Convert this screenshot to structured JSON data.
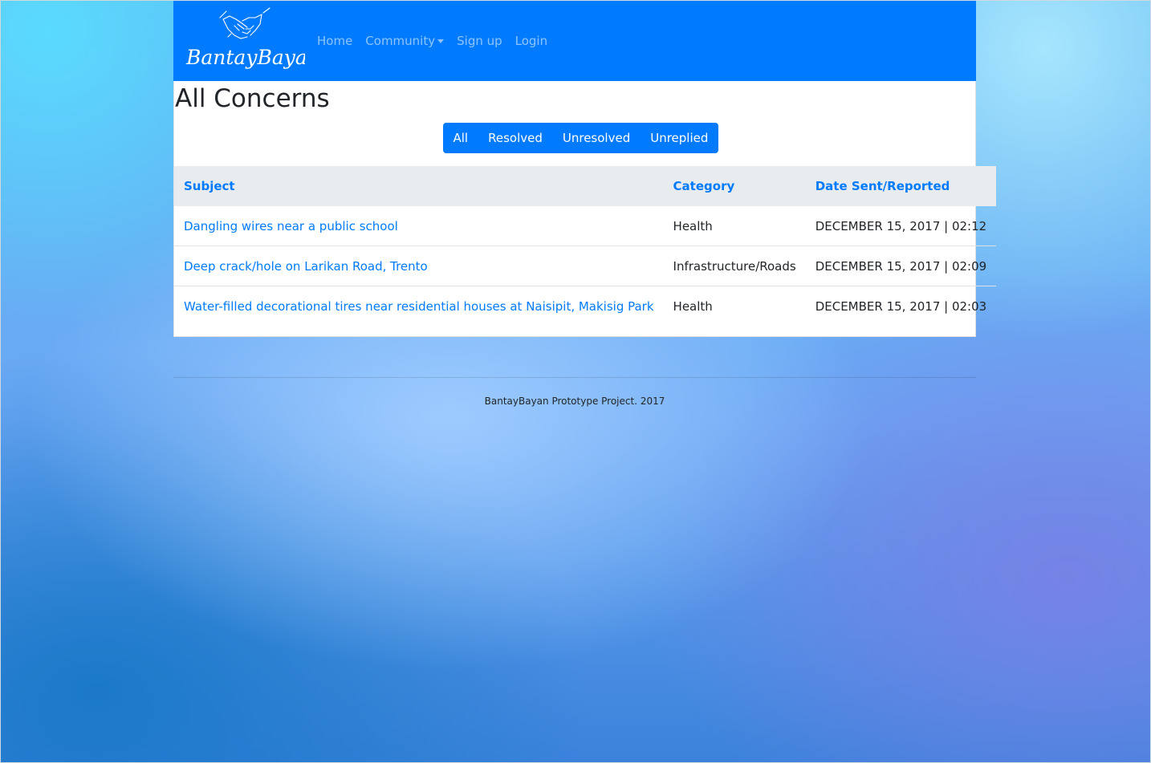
{
  "brand": {
    "logo_text": "BantayBayan",
    "logo_icon": "handshake-icon"
  },
  "nav": {
    "home": "Home",
    "community": "Community",
    "signup": "Sign up",
    "login": "Login"
  },
  "page": {
    "title": "All Concerns"
  },
  "filters": [
    "All",
    "Resolved",
    "Unresolved",
    "Unreplied"
  ],
  "table": {
    "headers": {
      "subject": "Subject",
      "category": "Category",
      "date": "Date Sent/Reported"
    },
    "rows": [
      {
        "subject": "Dangling wires near a public school",
        "category": "Health",
        "date": "DECEMBER 15, 2017 | 02:12"
      },
      {
        "subject": "Deep crack/hole on Larikan Road, Trento",
        "category": "Infrastructure/Roads",
        "date": "DECEMBER 15, 2017 | 02:09"
      },
      {
        "subject": "Water-filled decorational tires near residential houses at Naisipit, Makisig Park",
        "category": "Health",
        "date": "DECEMBER 15, 2017 | 02:03"
      }
    ]
  },
  "footer": {
    "text": "BantayBayan Prototype Project. 2017"
  },
  "colors": {
    "primary": "#007bff",
    "table_header_bg": "#e9ecef",
    "nav_link": "rgba(255,255,255,0.55)"
  }
}
